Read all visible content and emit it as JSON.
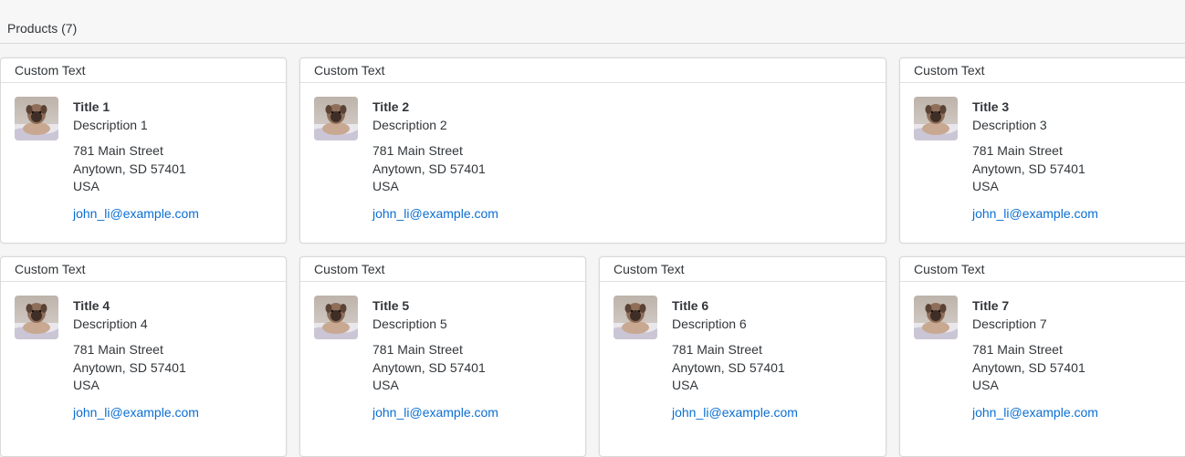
{
  "toolbar": {
    "title": "Products (7)"
  },
  "cards": [
    {
      "header": "Custom Text",
      "title": "Title 1",
      "description": "Description 1",
      "street": "781 Main Street",
      "city": "Anytown, SD 57401",
      "country": "USA",
      "email": "john_li@example.com"
    },
    {
      "header": "Custom Text",
      "title": "Title 2",
      "description": "Description 2",
      "street": "781 Main Street",
      "city": "Anytown, SD 57401",
      "country": "USA",
      "email": "john_li@example.com"
    },
    {
      "header": "Custom Text",
      "title": "Title 3",
      "description": "Description 3",
      "street": "781 Main Street",
      "city": "Anytown, SD 57401",
      "country": "USA",
      "email": "john_li@example.com"
    },
    {
      "header": "Custom Text",
      "title": "Title 4",
      "description": "Description 4",
      "street": "781 Main Street",
      "city": "Anytown, SD 57401",
      "country": "USA",
      "email": "john_li@example.com"
    },
    {
      "header": "Custom Text",
      "title": "Title 5",
      "description": "Description 5",
      "street": "781 Main Street",
      "city": "Anytown, SD 57401",
      "country": "USA",
      "email": "john_li@example.com"
    },
    {
      "header": "Custom Text",
      "title": "Title 6",
      "description": "Description 6",
      "street": "781 Main Street",
      "city": "Anytown, SD 57401",
      "country": "USA",
      "email": "john_li@example.com"
    },
    {
      "header": "Custom Text",
      "title": "Title 7",
      "description": "Description 7",
      "street": "781 Main Street",
      "city": "Anytown, SD 57401",
      "country": "USA",
      "email": "john_li@example.com"
    }
  ],
  "colors": {
    "link": "#0a6ed1",
    "text": "#32363a",
    "border": "#d9d9d9"
  }
}
